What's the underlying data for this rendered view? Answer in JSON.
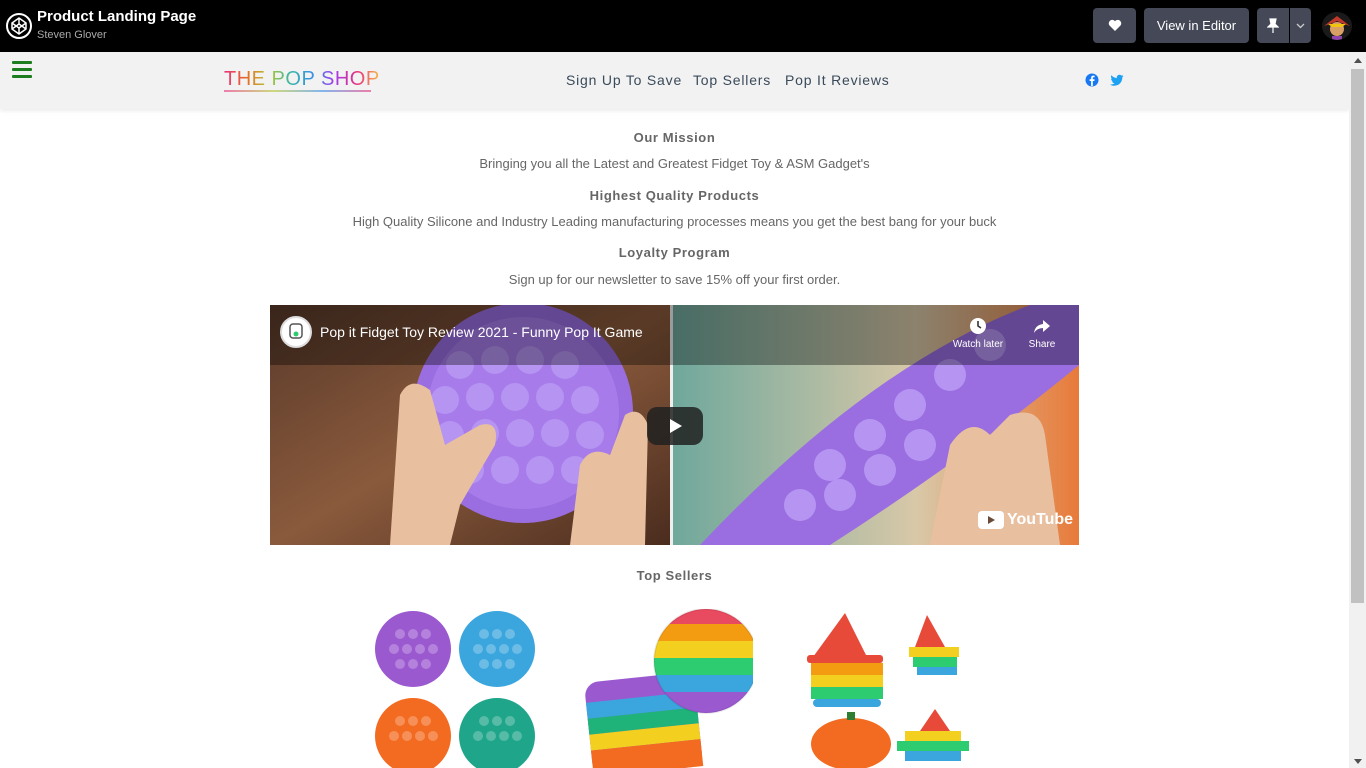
{
  "codepen": {
    "title": "Product Landing Page",
    "author": "Steven Glover",
    "view_in_editor": "View in Editor"
  },
  "header": {
    "logo": "THE POP SHOP",
    "nav": [
      "Sign Up To Save",
      "Top Sellers",
      "Pop It Reviews"
    ]
  },
  "mission": {
    "heading": "Our Mission",
    "text": "Bringing you all the Latest and Greatest Fidget Toy & ASM Gadget's"
  },
  "quality": {
    "heading": "Highest Quality Products",
    "text": "High Quality Silicone and Industry Leading manufacturing processes means you get the best bang for your buck"
  },
  "loyalty": {
    "heading": "Loyalty Program",
    "text": "Sign up for our newsletter to save 15% off your first order."
  },
  "video": {
    "title": "Pop it Fidget Toy Review 2021 - Funny Pop It Game",
    "watch_later": "Watch later",
    "share": "Share",
    "brand": "YouTube"
  },
  "top_sellers": {
    "heading": "Top Sellers"
  },
  "colors": {
    "codepen_bar": "#000000",
    "button": "#444857",
    "header_bg": "#f2f2f2",
    "hamburger": "#1e7d1e",
    "facebook": "#1877f2",
    "twitter": "#1da1f2"
  }
}
